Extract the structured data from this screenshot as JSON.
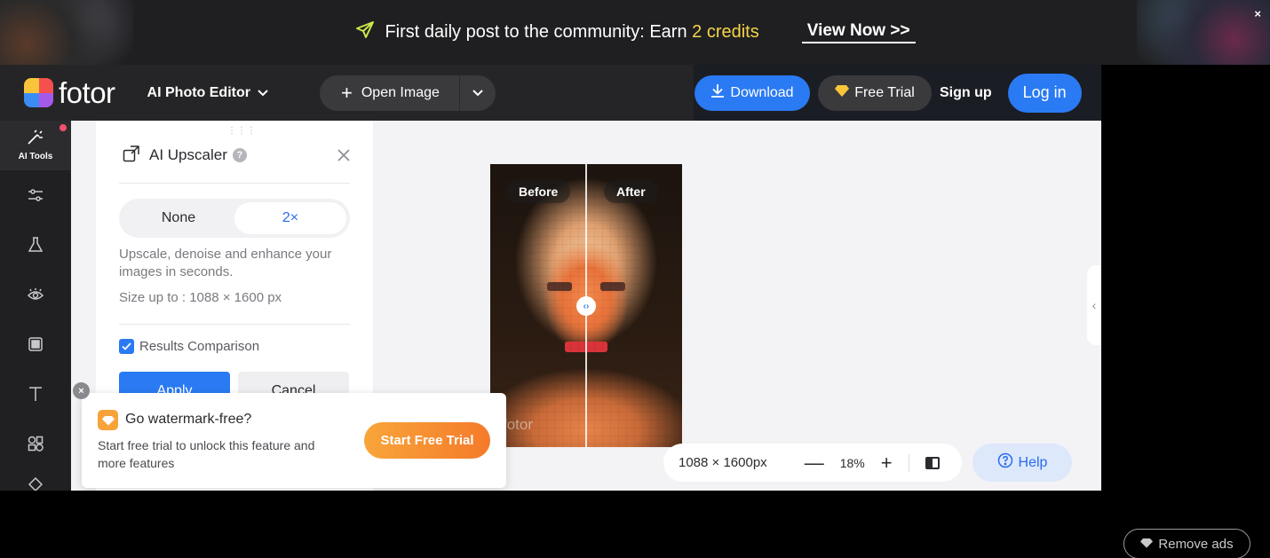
{
  "banner": {
    "text_prefix": "First daily post to the community: Earn ",
    "text_highlight": "2 credits",
    "cta": "View Now >>",
    "close": "×"
  },
  "header": {
    "logo_text": "fotor",
    "editor_menu": "AI Photo Editor",
    "open_image": "Open Image",
    "download": "Download",
    "free_trial": "Free Trial",
    "sign_up": "Sign up",
    "log_in": "Log in"
  },
  "rail": {
    "items": [
      {
        "label": "AI Tools",
        "icon": "ai-tools-icon"
      },
      {
        "icon": "adjust-icon"
      },
      {
        "icon": "beauty-icon"
      },
      {
        "icon": "eye-icon"
      },
      {
        "icon": "frame-icon"
      },
      {
        "icon": "text-icon"
      },
      {
        "icon": "elements-icon"
      },
      {
        "icon": "more-icon"
      }
    ]
  },
  "panel": {
    "title": "AI Upscaler",
    "options": [
      "None",
      "2×"
    ],
    "selected": "2×",
    "description": "Upscale, denoise and enhance your images in seconds.",
    "size": "Size up to : 1088 × 1600 px",
    "comparison_label": "Results Comparison",
    "comparison_checked": true,
    "apply": "Apply",
    "cancel": "Cancel"
  },
  "preview": {
    "before": "Before",
    "after": "After",
    "watermark": "fotor"
  },
  "zoom": {
    "dimensions": "1088 × 1600px",
    "level": "18%",
    "minus": "—",
    "plus": "+"
  },
  "help": "Help",
  "promo": {
    "title": "Go watermark-free?",
    "text": "Start free trial to unlock this feature and more features",
    "button": "Start Free Trial"
  },
  "remove_ads": "Remove ads",
  "colors": {
    "accent": "#2a7af3",
    "promo": "#f8a33a",
    "highlight": "#f5d54a"
  }
}
